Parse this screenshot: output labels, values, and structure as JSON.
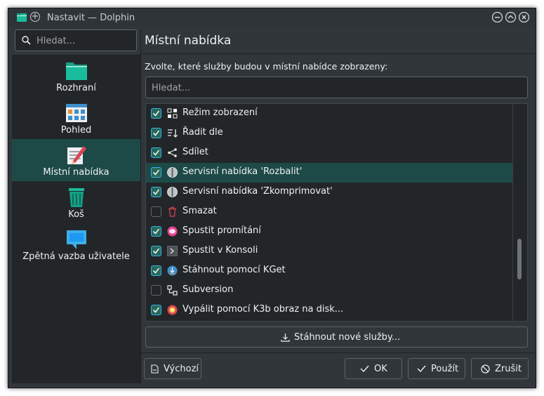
{
  "window": {
    "title": "Nastavit — Dolphin"
  },
  "sidebar": {
    "search_placeholder": "Hledat...",
    "items": [
      {
        "label": "Rozhraní",
        "icon": "folder-icon"
      },
      {
        "label": "Pohled",
        "icon": "view-icon"
      },
      {
        "label": "Místní nabídka",
        "icon": "context-menu-icon",
        "active": true
      },
      {
        "label": "Koš",
        "icon": "trash-icon"
      },
      {
        "label": "Zpětná vazba uživatele",
        "icon": "feedback-icon"
      }
    ]
  },
  "main": {
    "title": "Místní nabídka",
    "description": "Zvolte, které služby budou v místní nabídce zobrazeny:",
    "filter_placeholder": "Hledat...",
    "services": [
      {
        "label": "Režim zobrazení",
        "checked": true,
        "icon": "view-mode-icon"
      },
      {
        "label": "Řadit dle",
        "checked": true,
        "icon": "sort-icon"
      },
      {
        "label": "Sdílet",
        "checked": true,
        "icon": "share-icon"
      },
      {
        "label": "Servisní nabídka 'Rozbalit'",
        "checked": true,
        "icon": "archive-icon",
        "selected": true
      },
      {
        "label": "Servisní nabídka 'Zkomprimovat'",
        "checked": true,
        "icon": "archive-icon"
      },
      {
        "label": "Smazat",
        "checked": false,
        "icon": "delete-icon"
      },
      {
        "label": "Spustit promítání",
        "checked": true,
        "icon": "slideshow-icon"
      },
      {
        "label": "Spustit v Konsoli",
        "checked": true,
        "icon": "terminal-icon"
      },
      {
        "label": "Stáhnout pomocí KGet",
        "checked": true,
        "icon": "kget-icon"
      },
      {
        "label": "Subversion",
        "checked": false,
        "icon": "vcs-icon"
      },
      {
        "label": "Vypálit pomocí K3b obraz na disk...",
        "checked": true,
        "icon": "k3b-icon"
      }
    ],
    "download_button": "Stáhnout nové služby..."
  },
  "footer": {
    "defaults": "Výchozí",
    "ok": "OK",
    "apply": "Použít",
    "cancel": "Zrušit"
  },
  "colors": {
    "window_bg": "#31363b",
    "view_bg": "#232629",
    "selection": "#1d4a47",
    "checkbox_on": "#26695b",
    "focus": "#3daee9"
  }
}
